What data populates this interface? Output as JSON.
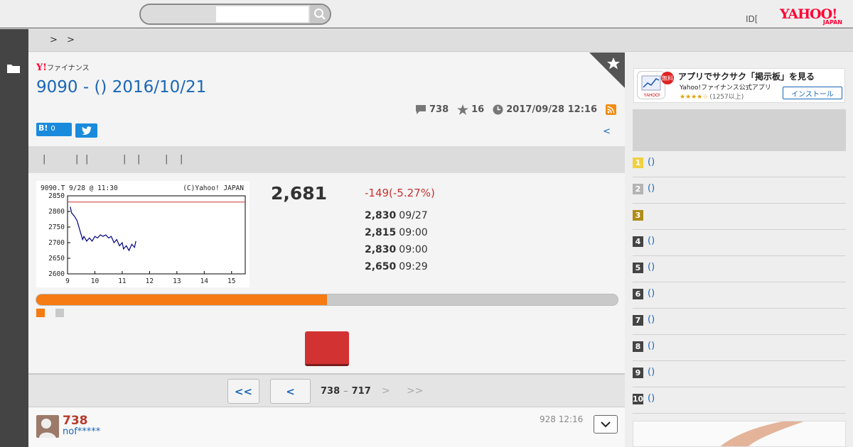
{
  "header": {
    "search_placeholder": "",
    "login_label": "ID[",
    "logo_text": "YAHOO!",
    "logo_sub": "JAPAN"
  },
  "breadcrumb": [
    ">",
    ">"
  ],
  "finance_logo": {
    "mark": "Y!",
    "text": "ファイナンス"
  },
  "title": "9090 - () 2016/10/21",
  "meta": {
    "comments": "738",
    "favorites": "16",
    "updated": "2017/09/28 12:16"
  },
  "share": {
    "hatena_label": "B!",
    "hatena_count": "0"
  },
  "back_link": "<",
  "tabs": [
    "|",
    "|",
    "|",
    "|",
    "|",
    "|",
    "|"
  ],
  "chart_data": {
    "type": "line",
    "title": "9090.T 9/28 @ 11:30",
    "credit": "(C)Yahoo! JAPAN",
    "x_ticks": [
      "9",
      "10",
      "11",
      "12",
      "13",
      "14",
      "15"
    ],
    "y_ticks": [
      "2850",
      "2800",
      "2750",
      "2700",
      "2650",
      "2600"
    ],
    "xlim": [
      9,
      15.5
    ],
    "ylim": [
      2600,
      2850
    ],
    "reference_line": 2830,
    "x": [
      9.1,
      9.15,
      9.25,
      9.35,
      9.45,
      9.55,
      9.6,
      9.7,
      9.8,
      9.9,
      10.0,
      10.1,
      10.2,
      10.3,
      10.4,
      10.5,
      10.6,
      10.7,
      10.8,
      10.9,
      11.0,
      11.05,
      11.15,
      11.25,
      11.35,
      11.45,
      11.5
    ],
    "values": [
      2815,
      2795,
      2785,
      2770,
      2740,
      2710,
      2720,
      2705,
      2715,
      2705,
      2720,
      2715,
      2725,
      2720,
      2725,
      2715,
      2720,
      2700,
      2710,
      2690,
      2700,
      2680,
      2690,
      2675,
      2695,
      2685,
      2705
    ]
  },
  "price": {
    "current": "2,681",
    "change": "-149(-5.27%)",
    "rows": [
      {
        "value": "2,830",
        "time": "09/27"
      },
      {
        "value": "2,815",
        "time": "09:00"
      },
      {
        "value": "2,830",
        "time": "09:00"
      },
      {
        "value": "2,650",
        "time": "09:29"
      }
    ]
  },
  "vote": {
    "fraction": 0.5
  },
  "pager": {
    "first": "<<",
    "prev": "<",
    "range_from": "738",
    "range_sep": "–",
    "range_to": "717",
    "next": ">",
    "last": ">>"
  },
  "comment": {
    "number": "738",
    "user": "nof*****",
    "time": "928 12:16"
  },
  "ad": {
    "badge": "無料",
    "title": "アプリでサクサク「掲示板」を見る",
    "subtitle": "Yahoo!ファイナンス公式アプリ",
    "stars": "★★★★☆",
    "reviews": "(1257以上)",
    "install": "インストール"
  },
  "ranking": [
    {
      "rank": "1",
      "label": "()",
      "color": "#f0d040"
    },
    {
      "rank": "2",
      "label": "()",
      "color": "#b4b4b4"
    },
    {
      "rank": "3",
      "label": "",
      "color": "#b08c1a"
    },
    {
      "rank": "4",
      "label": "()",
      "color": "#444444"
    },
    {
      "rank": "5",
      "label": "()",
      "color": "#444444"
    },
    {
      "rank": "6",
      "label": "()",
      "color": "#444444"
    },
    {
      "rank": "7",
      "label": "()",
      "color": "#444444"
    },
    {
      "rank": "8",
      "label": "()",
      "color": "#444444"
    },
    {
      "rank": "9",
      "label": "()",
      "color": "#444444"
    },
    {
      "rank": "10",
      "label": "()",
      "color": "#444444"
    }
  ]
}
